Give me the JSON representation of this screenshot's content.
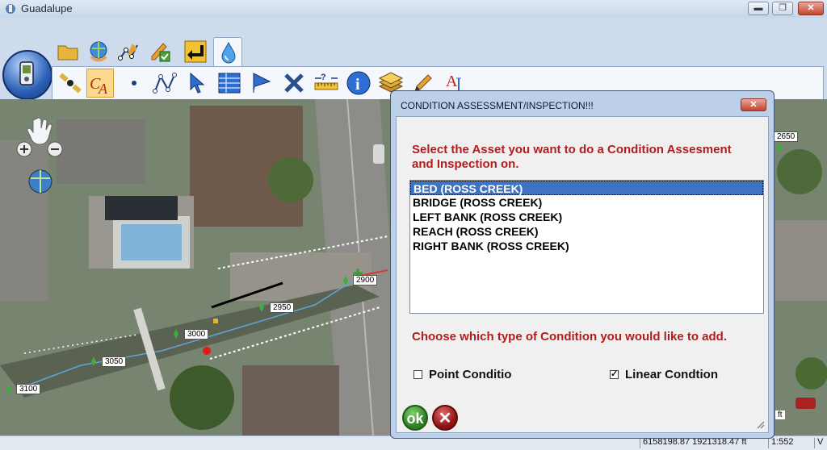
{
  "window": {
    "title": "Guadalupe",
    "minimize_label": "▬",
    "maximize_label": "❐",
    "close_label": "✕"
  },
  "ribbon": {
    "tabs": [
      {
        "icon": "folder-icon"
      },
      {
        "icon": "globe-hand-icon"
      },
      {
        "icon": "edit-network-icon"
      },
      {
        "icon": "edit-check-icon"
      },
      {
        "icon": "back-arrow-icon"
      },
      {
        "icon": "water-drop-icon",
        "active": true
      }
    ],
    "tools": [
      {
        "icon": "satellite-icon"
      },
      {
        "icon": "condition-assessment-icon",
        "label": "CA",
        "selected": true
      },
      {
        "icon": "point-icon"
      },
      {
        "icon": "polyline-icon"
      },
      {
        "icon": "select-arrow-icon"
      },
      {
        "icon": "attribute-table-icon"
      },
      {
        "icon": "flag-icon"
      },
      {
        "icon": "delete-x-icon"
      },
      {
        "icon": "measure-icon"
      },
      {
        "icon": "info-icon"
      },
      {
        "icon": "layers-icon"
      },
      {
        "icon": "pencil-icon"
      },
      {
        "icon": "annotation-text-icon",
        "label": "A"
      }
    ]
  },
  "map": {
    "stations": [
      "2650",
      "2900",
      "2950",
      "3000",
      "3050",
      "3100"
    ],
    "scale_fragment": "ft"
  },
  "statusbar": {
    "coordinates": "6158198.87 1921318.47 ft",
    "scale": "1:552",
    "mode": "V"
  },
  "dialog": {
    "title": "CONDITION ASSESSMENT/INSPECTION!!!",
    "close_label": "✕",
    "asset_prompt": "Select the Asset you want to do a Condition Assesment and Inspection on.",
    "assets": [
      "BED (ROSS CREEK)",
      "BRIDGE (ROSS CREEK)",
      "LEFT BANK (ROSS CREEK)",
      "REACH (ROSS CREEK)",
      "RIGHT BANK (ROSS CREEK)"
    ],
    "selected_asset_index": 0,
    "condition_prompt": "Choose which type of Condition you would like to add.",
    "point_condition_label": "Point Conditio",
    "point_condition_checked": false,
    "linear_condition_label": "Linear Condtion",
    "linear_condition_checked": true,
    "checked_mark": "✓",
    "ok_label": "ok",
    "cancel_label": "✕"
  }
}
